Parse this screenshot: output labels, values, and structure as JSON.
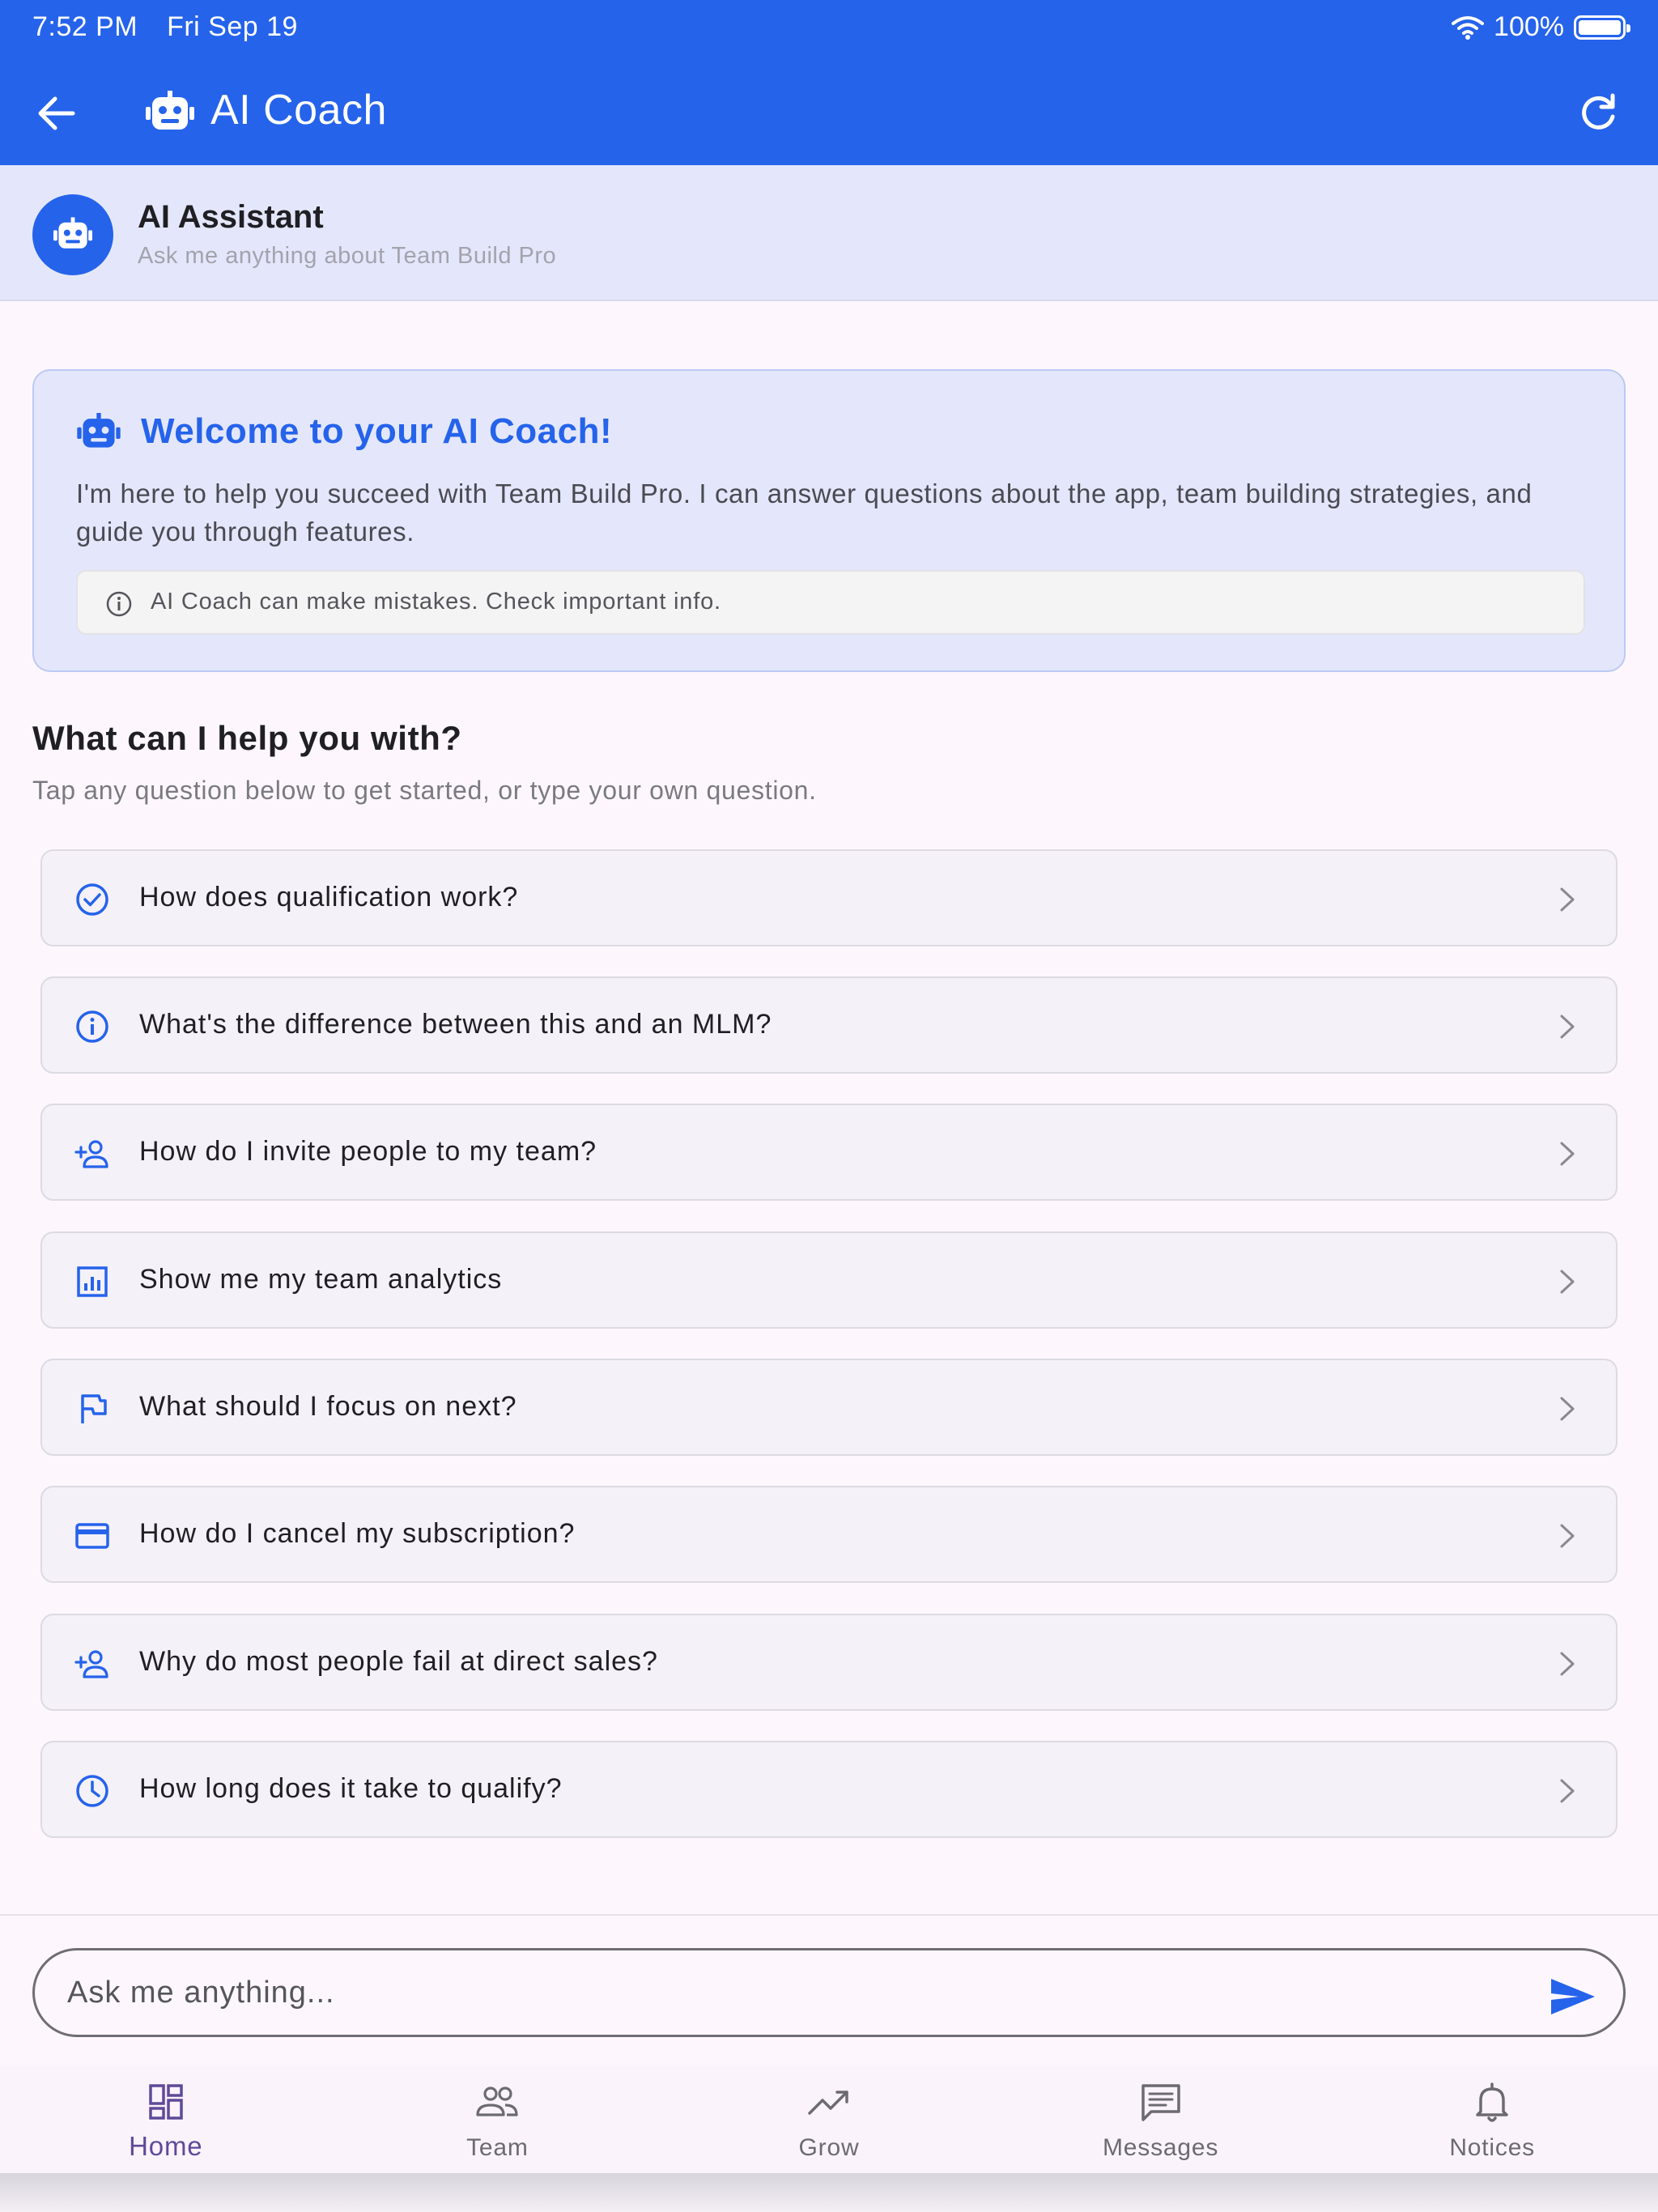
{
  "status_bar": {
    "time": "7:52 PM",
    "date": "Fri Sep 19",
    "battery": "100%"
  },
  "app_bar": {
    "title": "AI Coach",
    "color": "#2563eb"
  },
  "assistant": {
    "name": "AI Assistant",
    "subtitle": "Ask me anything about Team Build Pro"
  },
  "welcome": {
    "title": "Welcome to your AI Coach!",
    "text": "I'm here to help you succeed with Team Build Pro. I can answer questions about the app, team building strategies, and guide you through features.",
    "disclaimer": "AI Coach can make mistakes. Check important info."
  },
  "help": {
    "title": "What can I help you with?",
    "subtitle": "Tap any question below to get started, or type your own question."
  },
  "questions": [
    {
      "label": "How does qualification work?",
      "icon": "check-circle-icon"
    },
    {
      "label": "What's the difference between this and an MLM?",
      "icon": "info-icon"
    },
    {
      "label": "How do I invite people to my team?",
      "icon": "person-add-icon"
    },
    {
      "label": "Show me my team analytics",
      "icon": "analytics-icon"
    },
    {
      "label": "What should I focus on next?",
      "icon": "flag-icon"
    },
    {
      "label": "How do I cancel my subscription?",
      "icon": "credit-card-icon"
    },
    {
      "label": "Why do most people fail at direct sales?",
      "icon": "person-add-icon"
    },
    {
      "label": "How long does it take to qualify?",
      "icon": "clock-icon"
    }
  ],
  "chat_input": {
    "placeholder": "Ask me anything..."
  },
  "bottom_nav": [
    {
      "label": "Home",
      "icon": "dashboard-icon",
      "active": true
    },
    {
      "label": "Team",
      "icon": "people-icon",
      "active": false
    },
    {
      "label": "Grow",
      "icon": "trending-up-icon",
      "active": false
    },
    {
      "label": "Messages",
      "icon": "message-icon",
      "active": false
    },
    {
      "label": "Notices",
      "icon": "bell-icon",
      "active": false
    }
  ]
}
